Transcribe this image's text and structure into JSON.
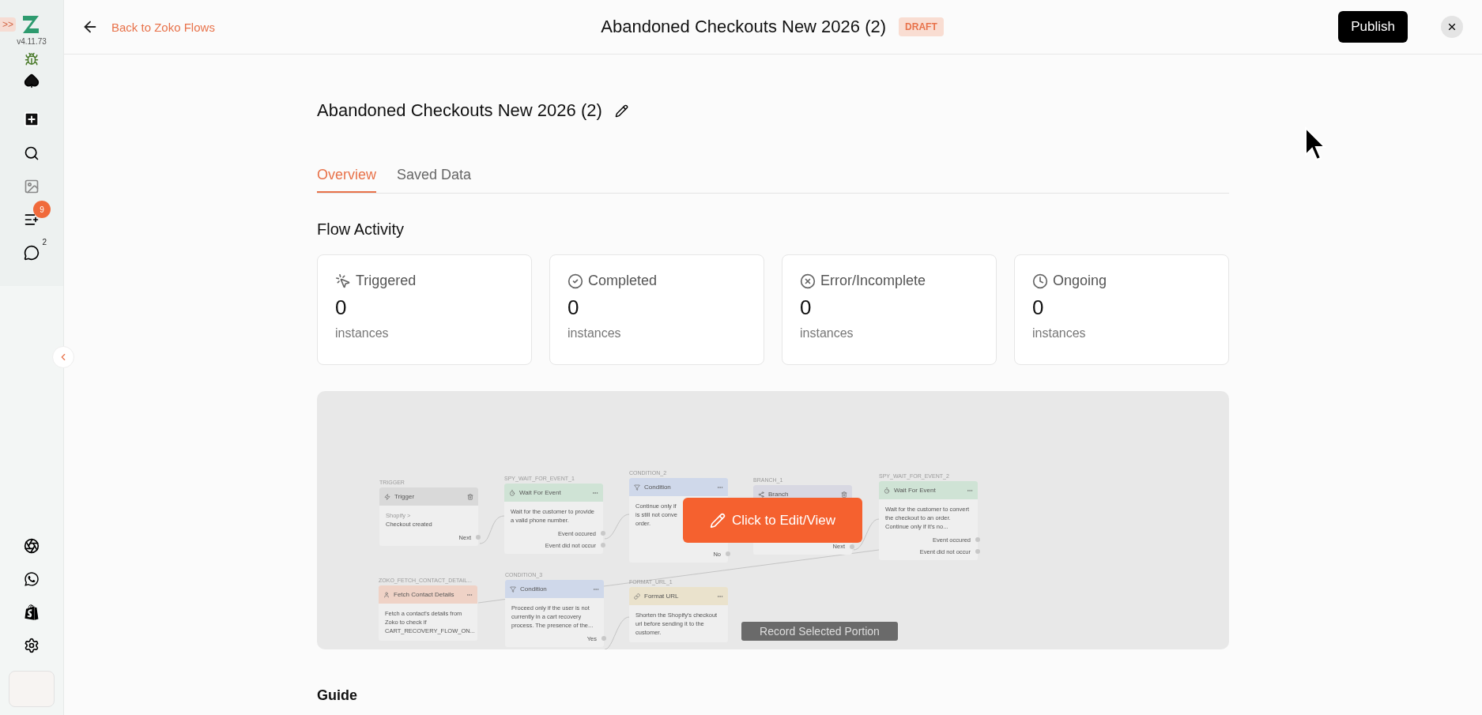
{
  "sidebar": {
    "expand_glyph": ">>",
    "version": "v4.11.73",
    "top_items": [
      {
        "kind": "bug"
      },
      {
        "kind": "spade"
      },
      {
        "kind": "add"
      },
      {
        "kind": "search"
      },
      {
        "kind": "image"
      },
      {
        "kind": "list",
        "badge": "9"
      },
      {
        "kind": "chat",
        "count": "2"
      }
    ],
    "bottom_items": [
      {
        "kind": "aperture"
      },
      {
        "kind": "whatsapp"
      },
      {
        "kind": "shopify"
      },
      {
        "kind": "settings"
      },
      {
        "kind": "avatar"
      }
    ]
  },
  "header": {
    "back_link": "Back to Zoko Flows",
    "title": "Abandoned Checkouts New 2026 (2)",
    "status": "DRAFT",
    "publish": "Publish"
  },
  "flow_name": "Abandoned Checkouts New 2026 (2)",
  "tabs": [
    {
      "label": "Overview",
      "selected": true
    },
    {
      "label": "Saved Data",
      "selected": false
    }
  ],
  "activity": {
    "title": "Flow Activity",
    "cards": [
      {
        "kind": "triggered",
        "label": "Triggered",
        "value": "0",
        "unit": "instances"
      },
      {
        "kind": "completed",
        "label": "Completed",
        "value": "0",
        "unit": "instances"
      },
      {
        "kind": "error",
        "label": "Error/Incomplete",
        "value": "0",
        "unit": "instances"
      },
      {
        "kind": "ongoing",
        "label": "Ongoing",
        "value": "0",
        "unit": "instances"
      }
    ]
  },
  "preview": {
    "nodes": [
      {
        "kind": "trigger",
        "id_label": "TRIGGER",
        "title": "Trigger",
        "color": "#d9d9d9",
        "body": [
          "Shopify >",
          "Checkout created"
        ],
        "outputs": [
          "Next"
        ]
      },
      {
        "kind": "wait",
        "id_label": "SPY_WAIT_FOR_EVENT_1",
        "title": "Wait For Event",
        "color": "#cfe3d5",
        "body": [
          "Wait for the customer to provide a valid phone number."
        ],
        "outputs": [
          "Event occured",
          "Event did not occur"
        ]
      },
      {
        "kind": "condition",
        "id_label": "CONDITION_2",
        "title": "Condition",
        "color": "#cfd8ea",
        "body": [
          "Continue only if",
          "is still not conve",
          "order."
        ],
        "outputs": [
          "No"
        ]
      },
      {
        "kind": "branch",
        "id_label": "BRANCH_1",
        "title": "Branch",
        "color": "#d8d8e2",
        "outputs": [
          "Next"
        ]
      },
      {
        "kind": "wait",
        "id_label": "SPY_WAIT_FOR_EVENT_2",
        "title": "Wait For Event",
        "color": "#cfe3d5",
        "body": [
          "Wait for the customer to convert the checkout to an order. Continue only if it's no..."
        ],
        "outputs": [
          "Event occured",
          "Event did not occur"
        ]
      },
      {
        "kind": "fetch",
        "id_label": "ZOKO_FETCH_CONTACT_DETAIL...",
        "title": "Fetch Contact Details",
        "color": "#efd2c6",
        "body": [
          "Fetch a contact's details from Zoko to check if CART_RECOVERY_FLOW_ON..."
        ]
      },
      {
        "kind": "condition",
        "id_label": "CONDITION_3",
        "title": "Condition",
        "color": "#cfd8ea",
        "body": [
          "Proceed only if the user is not currently in a cart recovery process. The presence of the..."
        ],
        "outputs": [
          "Yes"
        ]
      },
      {
        "kind": "format",
        "id_label": "FORMAT_URL_1",
        "title": "Format URL",
        "color": "#eae2cc",
        "body": [
          "Shorten the Shopify's checkout url before sending it to the customer."
        ]
      }
    ],
    "edit_button": "Click to Edit/View",
    "record_button": "Record Selected Portion"
  },
  "guide": {
    "title": "Guide"
  }
}
